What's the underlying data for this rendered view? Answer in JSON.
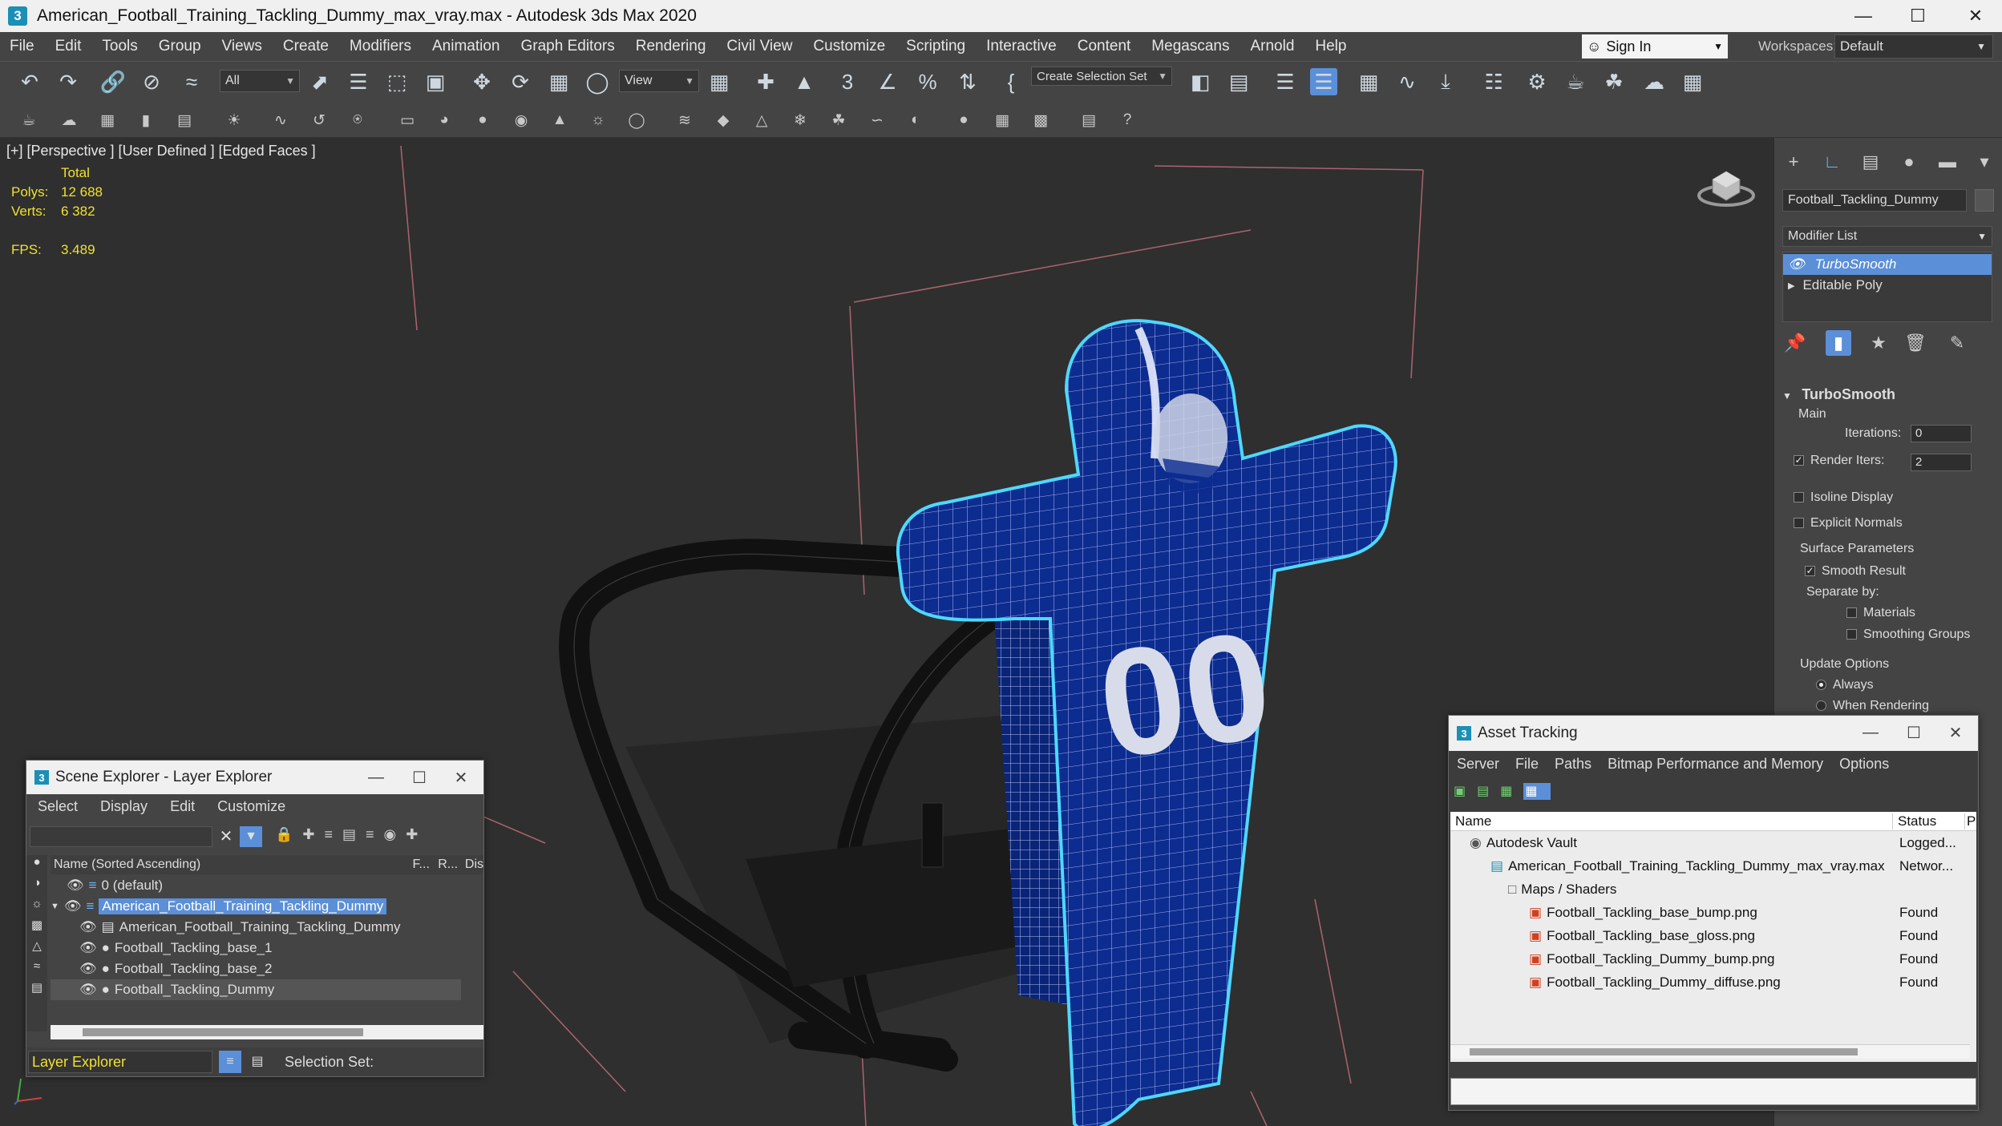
{
  "window": {
    "title": "American_Football_Training_Tackling_Dummy_max_vray.max - Autodesk 3ds Max 2020",
    "app_icon": "3"
  },
  "menu": [
    "File",
    "Edit",
    "Tools",
    "Group",
    "Views",
    "Create",
    "Modifiers",
    "Animation",
    "Graph Editors",
    "Rendering",
    "Civil View",
    "Customize",
    "Scripting",
    "Interactive",
    "Content",
    "Megascans",
    "Arnold",
    "Help"
  ],
  "account": {
    "sign_in": "Sign In",
    "workspaces_label": "Workspaces:",
    "workspace": "Default"
  },
  "toolbar": {
    "filter": "All",
    "ref_coord": "View",
    "selection_set": "Create Selection Set"
  },
  "viewport": {
    "label": "[+] [Perspective ] [User Defined ] [Edged Faces ]",
    "stats": {
      "header": "Total",
      "polys_label": "Polys:",
      "polys": "12 688",
      "verts_label": "Verts:",
      "verts": "6 382",
      "fps_label": "FPS:",
      "fps": "3.489"
    },
    "jersey_number": "00"
  },
  "command_panel": {
    "object_name": "Football_Tackling_Dummy",
    "modifier_list": "Modifier List",
    "stack": [
      "TurboSmooth",
      "Editable Poly"
    ],
    "rollout": {
      "title": "TurboSmooth",
      "main": "Main",
      "iterations_label": "Iterations:",
      "iterations": "0",
      "render_iters_label": "Render Iters:",
      "render_iters": "2",
      "isoline": "Isoline Display",
      "explicit_normals": "Explicit Normals",
      "surface_params": "Surface Parameters",
      "smooth_result": "Smooth Result",
      "separate_by": "Separate by:",
      "materials": "Materials",
      "smoothing_groups": "Smoothing Groups",
      "update_options": "Update Options",
      "always": "Always",
      "when_rendering": "When Rendering"
    }
  },
  "scene_explorer": {
    "title": "Scene Explorer - Layer Explorer",
    "menu": [
      "Select",
      "Display",
      "Edit",
      "Customize"
    ],
    "columns": {
      "name": "Name (Sorted Ascending)",
      "c2": "F...",
      "c3": "R...",
      "c4": "Dis"
    },
    "rows": [
      {
        "label": "0 (default)"
      },
      {
        "label": "American_Football_Training_Tackling_Dummy"
      },
      {
        "label": "American_Football_Training_Tackling_Dummy"
      },
      {
        "label": "Football_Tackling_base_1"
      },
      {
        "label": "Football_Tackling_base_2"
      },
      {
        "label": "Football_Tackling_Dummy"
      }
    ],
    "footer_layer": "Layer Explorer",
    "footer_selset": "Selection Set:"
  },
  "asset_tracking": {
    "title": "Asset Tracking",
    "menu": [
      "Server",
      "File",
      "Paths",
      "Bitmap Performance and Memory",
      "Options"
    ],
    "columns": {
      "name": "Name",
      "status": "Status",
      "extra": "P"
    },
    "rows": [
      {
        "name": "Autodesk Vault",
        "status": "Logged..."
      },
      {
        "name": "American_Football_Training_Tackling_Dummy_max_vray.max",
        "status": "Networ..."
      },
      {
        "name": "Maps / Shaders",
        "status": ""
      },
      {
        "name": "Football_Tackling_base_bump.png",
        "status": "Found"
      },
      {
        "name": "Football_Tackling_base_gloss.png",
        "status": "Found"
      },
      {
        "name": "Football_Tackling_Dummy_bump.png",
        "status": "Found"
      },
      {
        "name": "Football_Tackling_Dummy_diffuse.png",
        "status": "Found"
      }
    ]
  },
  "colors": {
    "accent": "#5b8fd8",
    "dummy_blue": "#0d2c8f",
    "selection_cyan": "#4fd8ff",
    "stat_yellow": "#f0e030"
  }
}
